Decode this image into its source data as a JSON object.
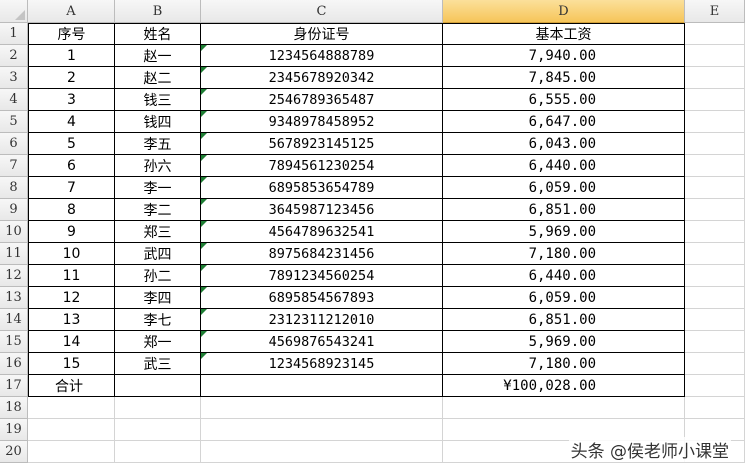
{
  "columns": [
    "A",
    "B",
    "C",
    "D",
    "E"
  ],
  "selected_column": "D",
  "row_numbers": [
    "1",
    "2",
    "3",
    "4",
    "5",
    "6",
    "7",
    "8",
    "9",
    "10",
    "11",
    "12",
    "13",
    "14",
    "15",
    "16",
    "17",
    "18",
    "19",
    "20"
  ],
  "headers": {
    "a": "序号",
    "b": "姓名",
    "c": "身份证号",
    "d": "基本工资"
  },
  "rows": [
    {
      "no": "1",
      "name": "赵一",
      "id": "1234564888789",
      "salary": "7,940.00"
    },
    {
      "no": "2",
      "name": "赵二",
      "id": "2345678920342",
      "salary": "7,845.00"
    },
    {
      "no": "3",
      "name": "钱三",
      "id": "2546789365487",
      "salary": "6,555.00"
    },
    {
      "no": "4",
      "name": "钱四",
      "id": "9348978458952",
      "salary": "6,647.00"
    },
    {
      "no": "5",
      "name": "李五",
      "id": "5678923145125",
      "salary": "6,043.00"
    },
    {
      "no": "6",
      "name": "孙六",
      "id": "7894561230254",
      "salary": "6,440.00"
    },
    {
      "no": "7",
      "name": "李一",
      "id": "6895853654789",
      "salary": "6,059.00"
    },
    {
      "no": "8",
      "name": "李二",
      "id": "3645987123456",
      "salary": "6,851.00"
    },
    {
      "no": "9",
      "name": "郑三",
      "id": "4564789632541",
      "salary": "5,969.00"
    },
    {
      "no": "10",
      "name": "武四",
      "id": "8975684231456",
      "salary": "7,180.00"
    },
    {
      "no": "11",
      "name": "孙二",
      "id": "7891234560254",
      "salary": "6,440.00"
    },
    {
      "no": "12",
      "name": "李四",
      "id": "6895854567893",
      "salary": "6,059.00"
    },
    {
      "no": "13",
      "name": "李七",
      "id": "2312311212010",
      "salary": "6,851.00"
    },
    {
      "no": "14",
      "name": "郑一",
      "id": "4569876543241",
      "salary": "5,969.00"
    },
    {
      "no": "15",
      "name": "武三",
      "id": "1234568923145",
      "salary": "7,180.00"
    }
  ],
  "total": {
    "label": "合计",
    "value": "¥100,028.00"
  },
  "watermark": "头条 @侯老师小课堂",
  "colors": {
    "selected_header": "#f6c55a",
    "error_indicator": "#1e7e34",
    "gridline": "#d4d4d4"
  }
}
